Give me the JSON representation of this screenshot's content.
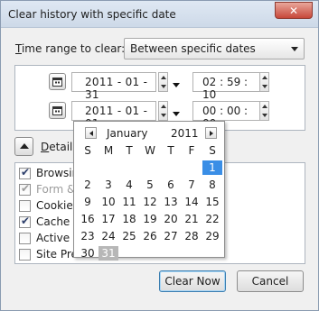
{
  "window": {
    "title": "Clear history with specific date",
    "close_glyph": "✕"
  },
  "time_range": {
    "label_prefix": "T",
    "label_rest": "ime range to clear:",
    "selected": "Between specific dates"
  },
  "start": {
    "date": "2011 - 01 - 31",
    "time": "02 : 59 : 10"
  },
  "end": {
    "date": "2011 - 01 - 01",
    "time": "00 : 00 : 00"
  },
  "details": {
    "label_prefix": "D",
    "label_rest": "etails"
  },
  "items": [
    {
      "label": "Browsing",
      "checked": true,
      "disabled": false
    },
    {
      "label": "Form &",
      "checked": true,
      "disabled": true
    },
    {
      "label": "Cookies",
      "checked": false,
      "disabled": false
    },
    {
      "label": "Cache",
      "checked": true,
      "disabled": false
    },
    {
      "label": "Active L",
      "checked": false,
      "disabled": false
    },
    {
      "label": "Site Pre",
      "checked": false,
      "disabled": false
    }
  ],
  "buttons": {
    "clear_now": "Clear Now",
    "cancel": "Cancel"
  },
  "calendar": {
    "month": "January",
    "year": "2011",
    "weekdays": [
      "S",
      "M",
      "T",
      "W",
      "T",
      "F",
      "S"
    ],
    "weeks": [
      [
        "",
        "",
        "",
        "",
        "",
        "",
        "1"
      ],
      [
        "2",
        "3",
        "4",
        "5",
        "6",
        "7",
        "8"
      ],
      [
        "9",
        "10",
        "11",
        "12",
        "13",
        "14",
        "15"
      ],
      [
        "16",
        "17",
        "18",
        "19",
        "20",
        "21",
        "22"
      ],
      [
        "23",
        "24",
        "25",
        "26",
        "27",
        "28",
        "29"
      ],
      [
        "30",
        "31",
        "",
        "",
        "",
        "",
        ""
      ]
    ],
    "selected_day": "1",
    "highlighted_day": "31",
    "selected_color": "#3a8ee6"
  },
  "icons": {
    "calendar_button": "calendar-icon",
    "spinner": "spinner-arrows-icon",
    "dropdown": "chevron-down-icon",
    "details_toggle": "chevron-up-icon"
  }
}
